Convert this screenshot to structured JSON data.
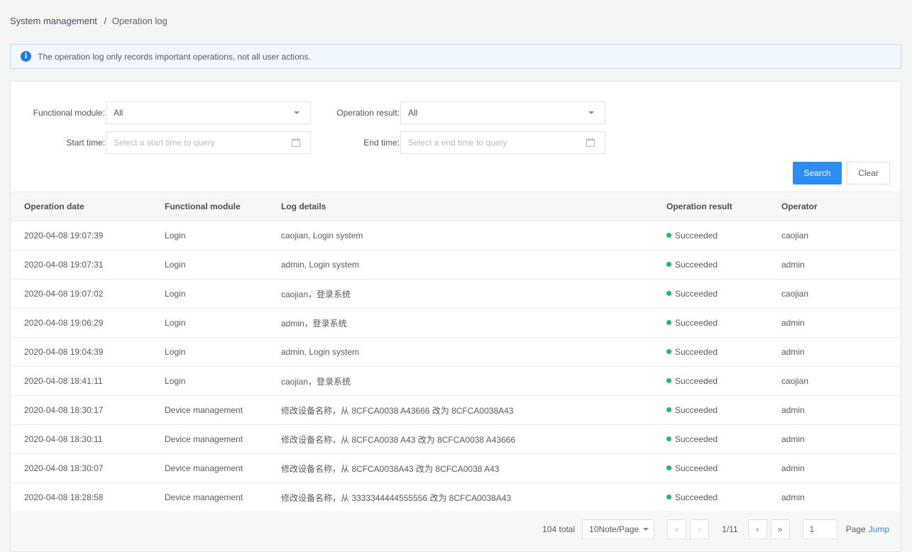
{
  "breadcrumb": {
    "parent": "System management",
    "separator": "/",
    "current": "Operation log"
  },
  "alert": {
    "icon": "info-icon",
    "text": "The operation log only records important operations, not all user actions."
  },
  "filters": {
    "functional_module": {
      "label": "Functional module:",
      "value": "All"
    },
    "operation_result": {
      "label": "Operation result:",
      "value": "All"
    },
    "start_time": {
      "label": "Start time:",
      "placeholder": "Select a start time to query"
    },
    "end_time": {
      "label": "End time:",
      "placeholder": "Select a end time to query"
    }
  },
  "buttons": {
    "search": "Search",
    "clear": "Clear"
  },
  "table": {
    "columns": [
      "Operation date",
      "Functional module",
      "Log details",
      "Operation result",
      "Operator"
    ],
    "status_color": "#19be6b",
    "rows": [
      {
        "date": "2020-04-08 19:07:39",
        "module": "Login",
        "details": "caojian, Login system",
        "result": "Succeeded",
        "operator": "caojian"
      },
      {
        "date": "2020-04-08 19:07:31",
        "module": "Login",
        "details": "admin, Login system",
        "result": "Succeeded",
        "operator": "admin"
      },
      {
        "date": "2020-04-08 19:07:02",
        "module": "Login",
        "details": "caojian，登录系统",
        "result": "Succeeded",
        "operator": "caojian"
      },
      {
        "date": "2020-04-08 19:06:29",
        "module": "Login",
        "details": "admin，登录系统",
        "result": "Succeeded",
        "operator": "admin"
      },
      {
        "date": "2020-04-08 19:04:39",
        "module": "Login",
        "details": "admin, Login system",
        "result": "Succeeded",
        "operator": "admin"
      },
      {
        "date": "2020-04-08 18:41:11",
        "module": "Login",
        "details": "caojian，登录系统",
        "result": "Succeeded",
        "operator": "caojian"
      },
      {
        "date": "2020-04-08 18:30:17",
        "module": "Device management",
        "details": "修改设备名称，从 8CFCA0038 A43666 改为 8CFCA0038A43",
        "result": "Succeeded",
        "operator": "admin"
      },
      {
        "date": "2020-04-08 18:30:11",
        "module": "Device management",
        "details": "修改设备名称，从 8CFCA0038 A43 改为 8CFCA0038 A43666",
        "result": "Succeeded",
        "operator": "admin"
      },
      {
        "date": "2020-04-08 18:30:07",
        "module": "Device management",
        "details": "修改设备名称，从 8CFCA0038A43 改为 8CFCA0038 A43",
        "result": "Succeeded",
        "operator": "admin"
      },
      {
        "date": "2020-04-08 18:28:58",
        "module": "Device management",
        "details": "修改设备名称，从 3333344444555556 改为 8CFCA0038A43",
        "result": "Succeeded",
        "operator": "admin"
      }
    ]
  },
  "pagination": {
    "total": "104 total",
    "page_size": "10Note/Page",
    "first": "«",
    "prev": "‹",
    "next": "›",
    "last": "»",
    "page_indicator": "1/11",
    "jump_value": "1",
    "page_label": "Page",
    "jump_label": "Jump"
  }
}
